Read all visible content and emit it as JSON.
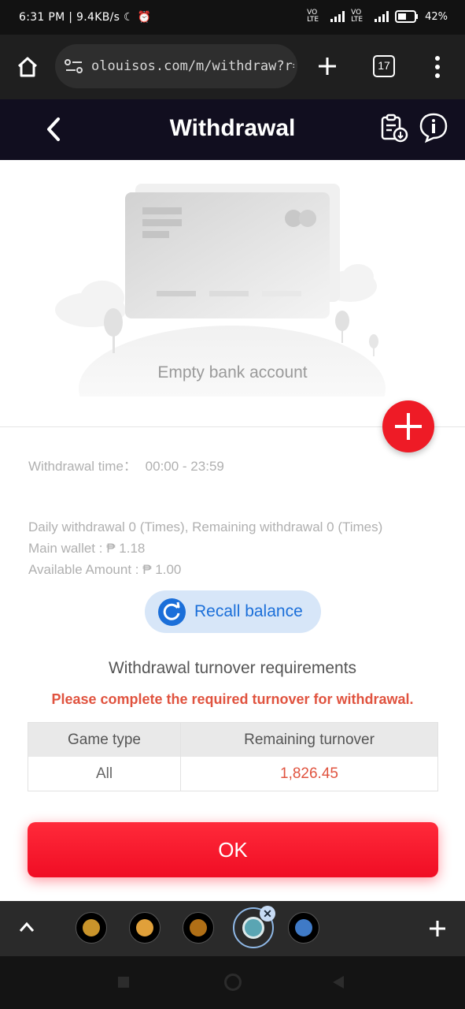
{
  "status_bar": {
    "time": "6:31 PM",
    "speed": "9.4KB/s",
    "net1": "VO LTE",
    "net2": "VO LTE",
    "battery": "42%"
  },
  "browser": {
    "url": "olouisos.com/m/withdraw?r=b:",
    "tab_count": "17"
  },
  "header": {
    "title": "Withdrawal"
  },
  "bank": {
    "empty_text": "Empty bank account"
  },
  "info": {
    "time_label": "Withdrawal time：",
    "time_value": "00:00 - 23:59",
    "daily": "Daily withdrawal 0 (Times), Remaining withdrawal 0 (Times)",
    "main_wallet": "Main wallet : ₱ 1.18",
    "available": "Available Amount : ₱ 1.00"
  },
  "recall": {
    "label": "Recall balance"
  },
  "requirements": {
    "title": "Withdrawal turnover requirements",
    "warning": "Please complete the required turnover for withdrawal.",
    "columns": [
      "Game type",
      "Remaining turnover"
    ],
    "rows": [
      {
        "game_type": "All",
        "remaining": "1,826.45"
      }
    ]
  },
  "ok_label": "OK",
  "colors": {
    "accent_red": "#ee1b26",
    "warning": "#e0533f",
    "recall_blue": "#1b6fd9",
    "header_bg": "#110e1f"
  }
}
